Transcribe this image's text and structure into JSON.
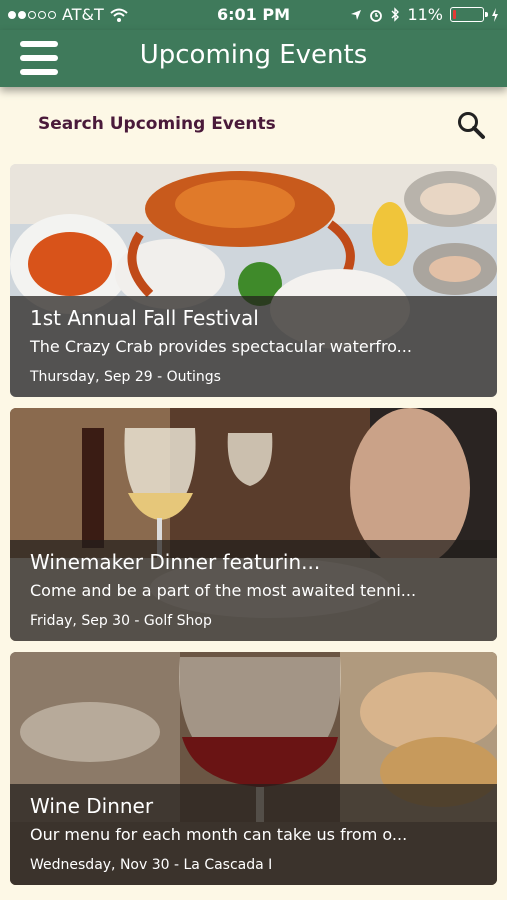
{
  "status_bar": {
    "carrier": "AT&T",
    "time": "6:01 PM",
    "battery": "11%",
    "battery_level": 0.11
  },
  "header": {
    "title": "Upcoming Events"
  },
  "search": {
    "placeholder": "Search Upcoming Events"
  },
  "events": [
    {
      "title": "1st Annual Fall Festival",
      "description": "The Crazy Crab provides spectacular waterfro...",
      "meta": "Thursday, Sep 29 - Outings"
    },
    {
      "title": " Winemaker Dinner featurin...",
      "description": "Come and be a part of the most awaited tenni...",
      "meta": "Friday, Sep 30 - Golf Shop"
    },
    {
      "title": "Wine Dinner",
      "description": "Our menu for each month can take us from o...",
      "meta": "Wednesday, Nov 30 - La Cascada I"
    }
  ],
  "colors": {
    "header": "#3f7a5b",
    "background": "#fdf8e6",
    "search_text": "#4a1a3a",
    "battery": "#e53935"
  }
}
